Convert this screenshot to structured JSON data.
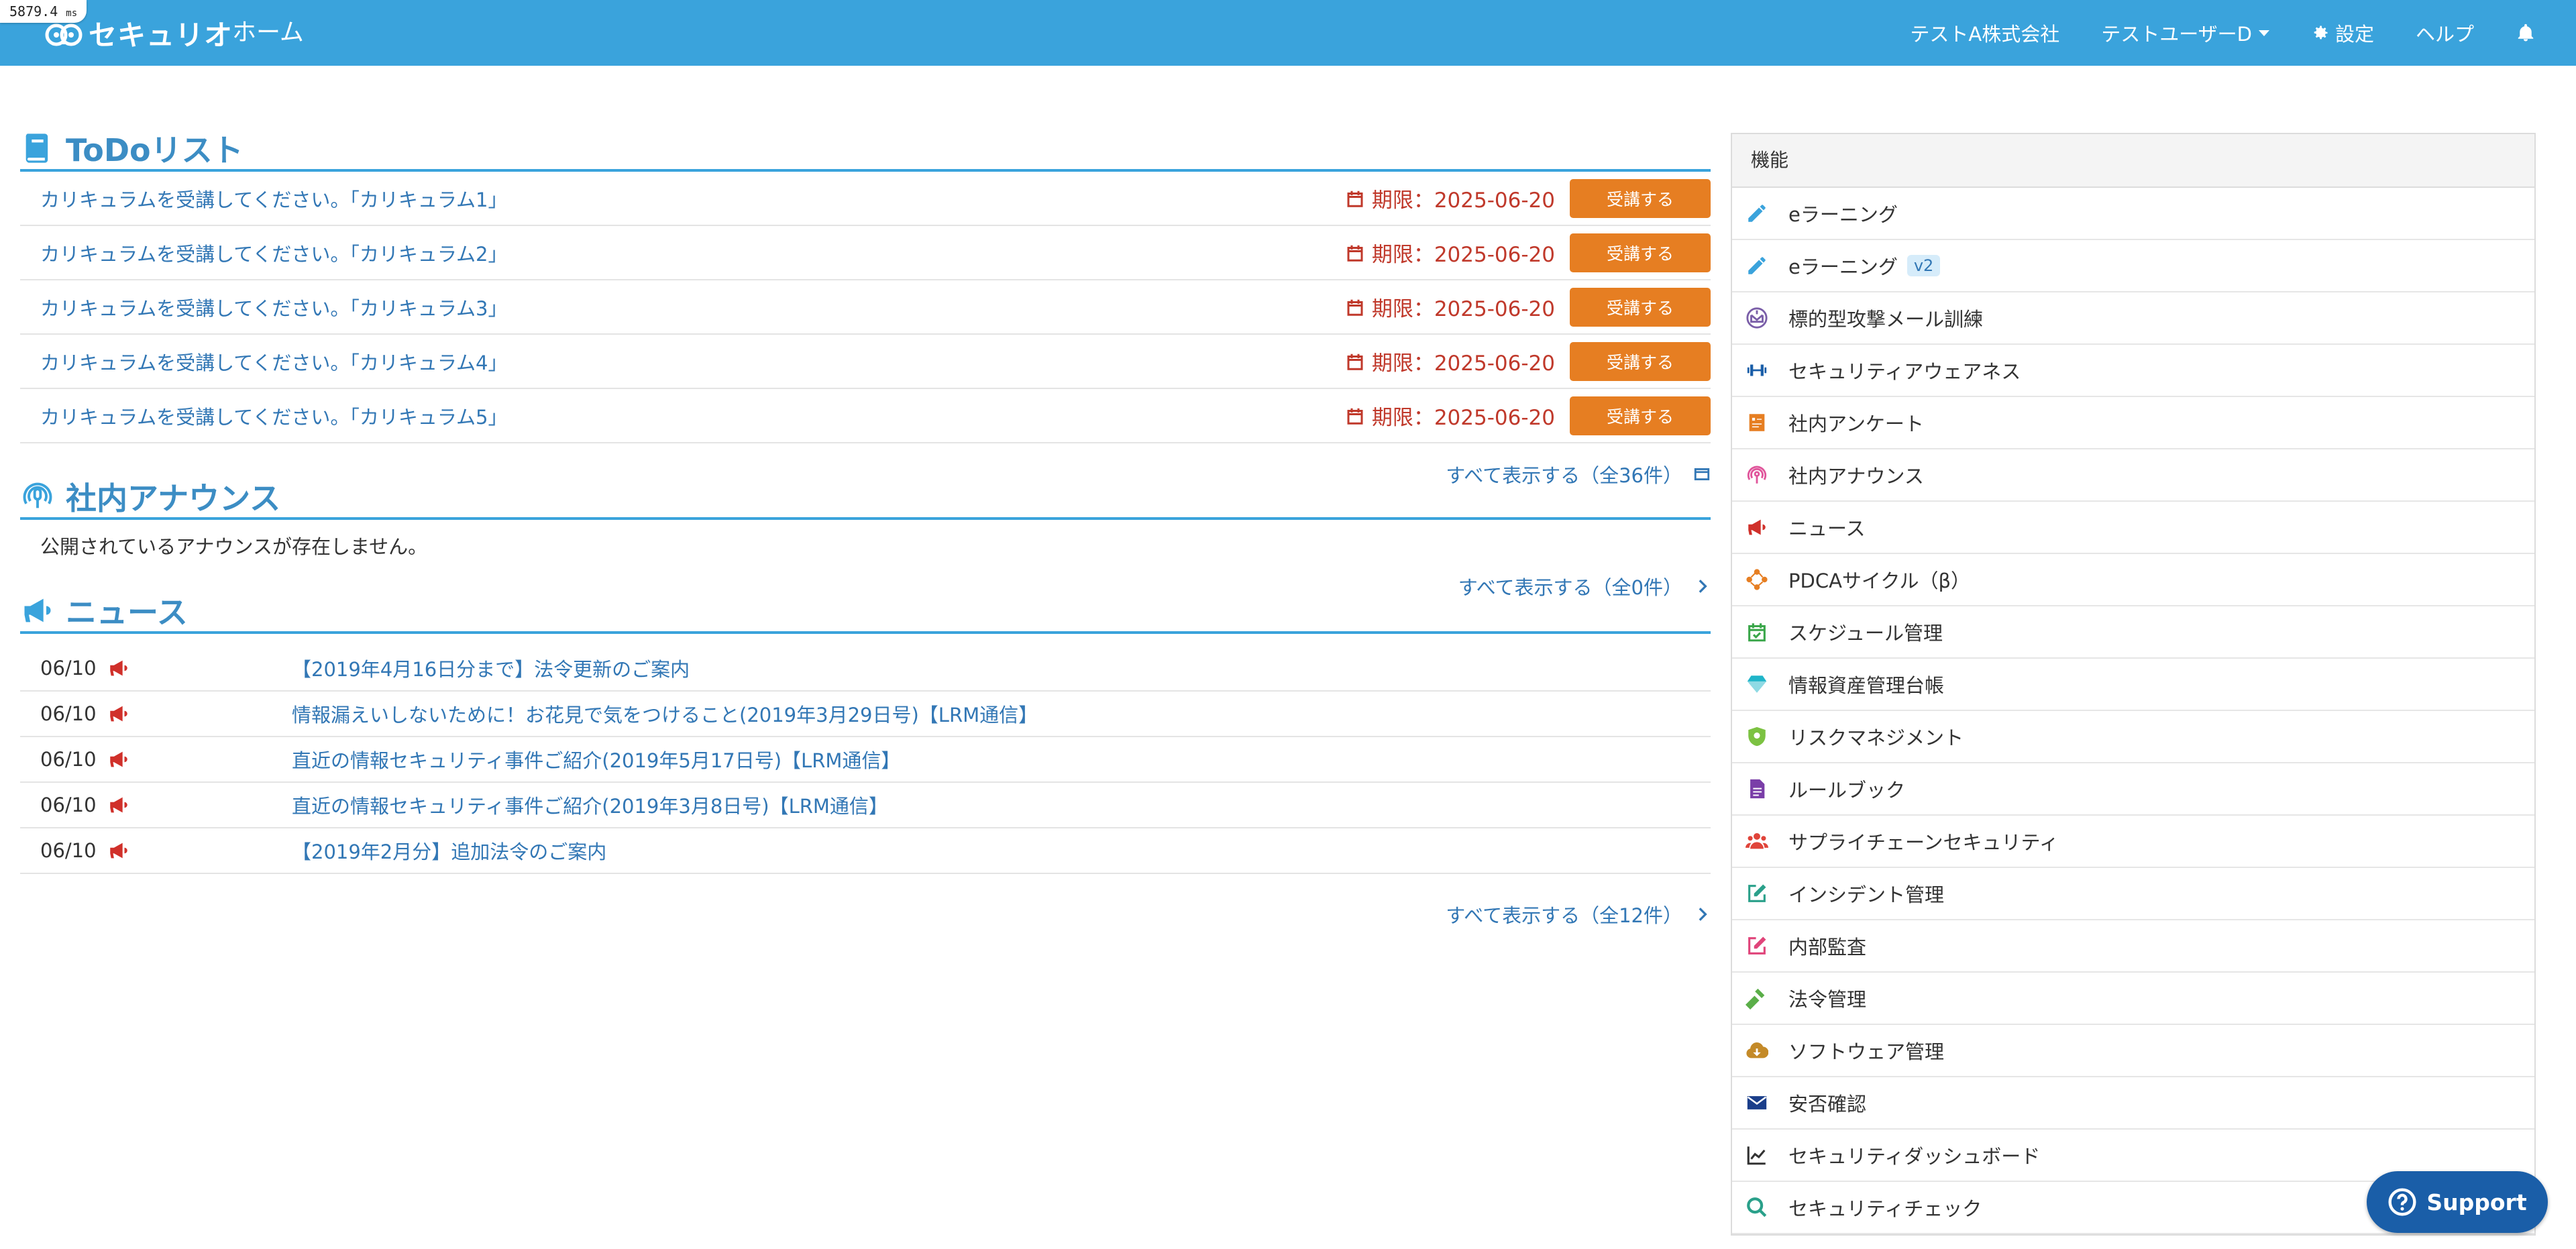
{
  "timing": {
    "value": "5879.4",
    "unit": "ms"
  },
  "header": {
    "logo_text": "セキュリオ",
    "home": "ホーム",
    "company": "テストA株式会社",
    "user": "テストユーザーD",
    "settings": "設定",
    "help": "ヘルプ"
  },
  "todo": {
    "title": "ToDoリスト",
    "items": [
      {
        "text": "カリキュラムを受講してください。「カリキュラム1」",
        "deadline": "期限：2025-06-20",
        "button": "受講する"
      },
      {
        "text": "カリキュラムを受講してください。「カリキュラム2」",
        "deadline": "期限：2025-06-20",
        "button": "受講する"
      },
      {
        "text": "カリキュラムを受講してください。「カリキュラム3」",
        "deadline": "期限：2025-06-20",
        "button": "受講する"
      },
      {
        "text": "カリキュラムを受講してください。「カリキュラム4」",
        "deadline": "期限：2025-06-20",
        "button": "受講する"
      },
      {
        "text": "カリキュラムを受講してください。「カリキュラム5」",
        "deadline": "期限：2025-06-20",
        "button": "受講する"
      }
    ],
    "show_all": "すべて表示する（全36件）"
  },
  "announce": {
    "title": "社内アナウンス",
    "empty": "公開されているアナウンスが存在しません。",
    "show_all": "すべて表示する（全0件）"
  },
  "news": {
    "title": "ニュース",
    "items": [
      {
        "date": "06/10",
        "title": "【2019年4月16日分まで】法令更新のご案内"
      },
      {
        "date": "06/10",
        "title": "情報漏えいしないために！お花見で気をつけること(2019年3月29日号)【LRM通信】"
      },
      {
        "date": "06/10",
        "title": "直近の情報セキュリティ事件ご紹介(2019年5月17日号)【LRM通信】"
      },
      {
        "date": "06/10",
        "title": "直近の情報セキュリティ事件ご紹介(2019年3月8日号)【LRM通信】"
      },
      {
        "date": "06/10",
        "title": "【2019年2月分】追加法令のご案内"
      }
    ],
    "show_all": "すべて表示する（全12件）"
  },
  "features": {
    "title": "機能",
    "items": [
      {
        "label": "eラーニング",
        "icon": "pencil-icon",
        "color": "#3aa3dc"
      },
      {
        "label": "eラーニング",
        "badge": "v2",
        "icon": "pencil-icon",
        "color": "#3aa3dc"
      },
      {
        "label": "標的型攻撃メール訓練",
        "icon": "mail-hook-icon",
        "color": "#7a5ea8"
      },
      {
        "label": "セキュリティアウェアネス",
        "icon": "dumbbell-icon",
        "color": "#1a5ea8"
      },
      {
        "label": "社内アンケート",
        "icon": "survey-icon",
        "color": "#e67e22"
      },
      {
        "label": "社内アナウンス",
        "icon": "broadcast-icon",
        "color": "#e0559b"
      },
      {
        "label": "ニュース",
        "icon": "megaphone-icon",
        "color": "#d0302a"
      },
      {
        "label": "PDCAサイクル（β）",
        "icon": "cycle-icon",
        "color": "#e67e22"
      },
      {
        "label": "スケジュール管理",
        "icon": "calendar-check-icon",
        "color": "#3aa64a"
      },
      {
        "label": "情報資産管理台帳",
        "icon": "diamond-icon",
        "color": "#1fb5c9"
      },
      {
        "label": "リスクマネジメント",
        "icon": "shield-icon",
        "color": "#7cc242"
      },
      {
        "label": "ルールブック",
        "icon": "document-icon",
        "color": "#7a3ea8"
      },
      {
        "label": "サプライチェーンセキュリティ",
        "icon": "users-icon",
        "color": "#e0443a"
      },
      {
        "label": "インシデント管理",
        "icon": "edit-icon",
        "color": "#2aa08a"
      },
      {
        "label": "内部監査",
        "icon": "edit-icon",
        "color": "#e0447a"
      },
      {
        "label": "法令管理",
        "icon": "gavel-icon",
        "color": "#5aae48"
      },
      {
        "label": "ソフトウェア管理",
        "icon": "cloud-download-icon",
        "color": "#c48a28"
      },
      {
        "label": "安否確認",
        "icon": "envelope-icon",
        "color": "#1a3e8a"
      },
      {
        "label": "セキュリティダッシュボード",
        "icon": "line-chart-icon",
        "color": "#333333"
      },
      {
        "label": "セキュリティチェック",
        "icon": "search-icon",
        "color": "#2aa08a"
      }
    ]
  },
  "support": "Support"
}
